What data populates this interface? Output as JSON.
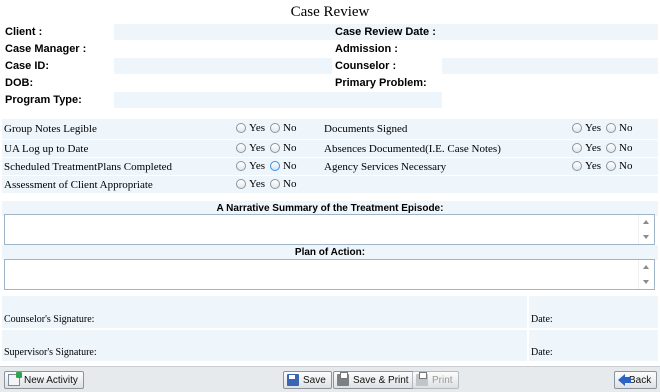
{
  "page": {
    "title": "Case Review"
  },
  "info": {
    "rows": [
      {
        "left": "Client :",
        "right": "Case Review Date :"
      },
      {
        "left": "Case Manager :",
        "right": "Admission :"
      },
      {
        "left": "Case ID:",
        "right": "Counselor :"
      },
      {
        "left": "DOB:",
        "right": "Primary Problem:"
      },
      {
        "left": "Program Type:",
        "right": ""
      }
    ]
  },
  "radio": {
    "yes": "Yes",
    "no": "No"
  },
  "checks": {
    "rows": [
      {
        "left": "Group Notes Legible",
        "right": "Documents Signed"
      },
      {
        "left": "UA Log up to Date",
        "right": "Absences Documented(I.E. Case Notes)"
      },
      {
        "left": "Scheduled TreatmentPlans Completed",
        "right": "Agency Services Necessary"
      },
      {
        "left": "Assessment of Client Appropriate",
        "right": ""
      }
    ]
  },
  "narrative": {
    "label": "A Narrative Summary of the Treatment Episode:"
  },
  "plan": {
    "label": "Plan of Action:"
  },
  "signatures": {
    "counselor": "Counselor's Signature:",
    "supervisor": "Supervisor's Signature:",
    "date": "Date:"
  },
  "toolbar": {
    "new_activity": "New Activity",
    "save": "Save",
    "save_print": "Save & Print",
    "print": "Print",
    "back": "Back"
  }
}
